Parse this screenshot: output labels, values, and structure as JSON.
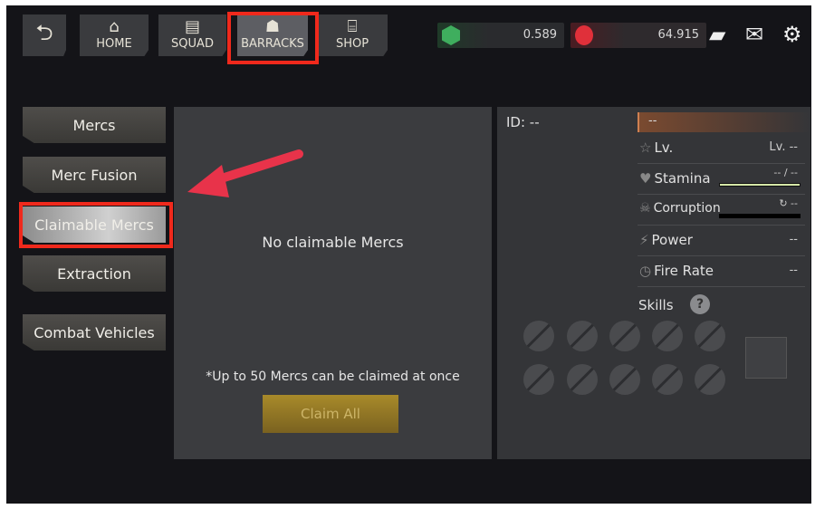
{
  "topbar": {
    "back_icon": "undo-arrow-icon",
    "tabs": [
      {
        "label": "HOME",
        "icon": "house-icon"
      },
      {
        "label": "SQUAD",
        "icon": "garage-icon"
      },
      {
        "label": "BARRACKS",
        "icon": "soldier-icon",
        "active": true
      },
      {
        "label": "SHOP",
        "icon": "store-icon"
      }
    ],
    "currencies": [
      {
        "icon": "green-gem-icon",
        "value": "0.589",
        "color": "#3fae5e"
      },
      {
        "icon": "red-ruby-icon",
        "value": "64.915",
        "color": "#e0303a"
      }
    ],
    "icons": [
      "wallet-icon",
      "mail-icon",
      "gear-icon"
    ]
  },
  "sidebar": {
    "items": [
      {
        "label": "Mercs"
      },
      {
        "label": "Merc Fusion"
      },
      {
        "label": "Claimable Mercs",
        "selected": true
      },
      {
        "label": "Extraction"
      },
      {
        "label": "Combat Vehicles"
      }
    ]
  },
  "main": {
    "empty_text": "No claimable Mercs",
    "note": "*Up to 50 Mercs can be claimed at once",
    "claim_all": "Claim All"
  },
  "detail": {
    "id": "ID: --",
    "name": "--",
    "stats": [
      {
        "label": "Lv.",
        "value": "Lv. --",
        "icon": "star-icon"
      },
      {
        "label": "Stamina",
        "value": "-- / --",
        "icon": "heart-icon"
      },
      {
        "label": "Corruption",
        "value": "--",
        "icon": "skull-icon"
      },
      {
        "label": "Power",
        "value": "--",
        "icon": "power-icon"
      },
      {
        "label": "Fire Rate",
        "value": "--",
        "icon": "clock-icon"
      }
    ],
    "skills_label": "Skills",
    "help": "?"
  },
  "annotation": {
    "highlight_color": "#f0291c"
  }
}
